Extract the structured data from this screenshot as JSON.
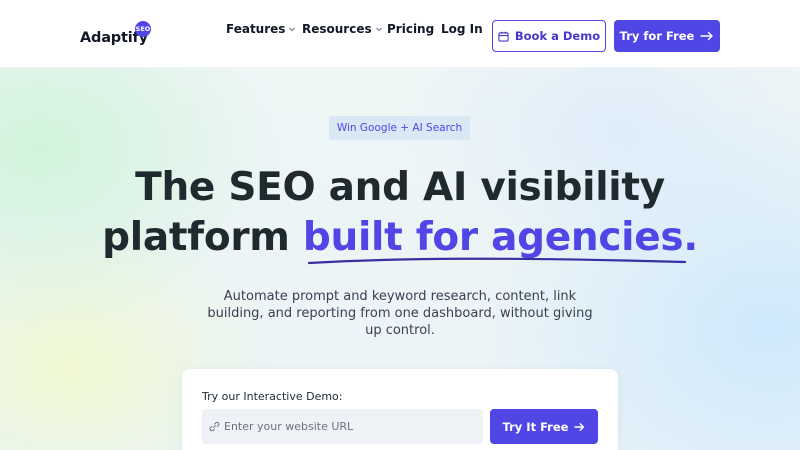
{
  "header": {
    "logo_text": "Adaptify",
    "logo_badge": "SEO",
    "nav": {
      "features": "Features",
      "resources": "Resources",
      "pricing": "Pricing",
      "login": "Log In"
    },
    "book_demo_label": "Book a Demo",
    "try_free_label": "Try for Free"
  },
  "hero": {
    "pill": "Win Google + AI Search",
    "headline_line1": "The SEO and AI visibility",
    "headline_line2_plain": "platform ",
    "headline_line2_accent": "built for agencies.",
    "subtext_lines": [
      "Automate prompt and keyword research, content, link",
      "building, and reporting from one dashboard, without giving",
      "up control."
    ]
  },
  "demo_card": {
    "label": "Try our Interactive Demo:",
    "url_placeholder": "Enter your website URL",
    "url_value": "",
    "submit_label": "Try It Free"
  },
  "colors": {
    "accent": "#4f46e5",
    "heading": "#1f2a2e"
  },
  "icons": {
    "calendar": "calendar-icon",
    "arrow": "arrow-right-icon",
    "link": "link-icon",
    "chevron": "chevron-down-icon"
  }
}
